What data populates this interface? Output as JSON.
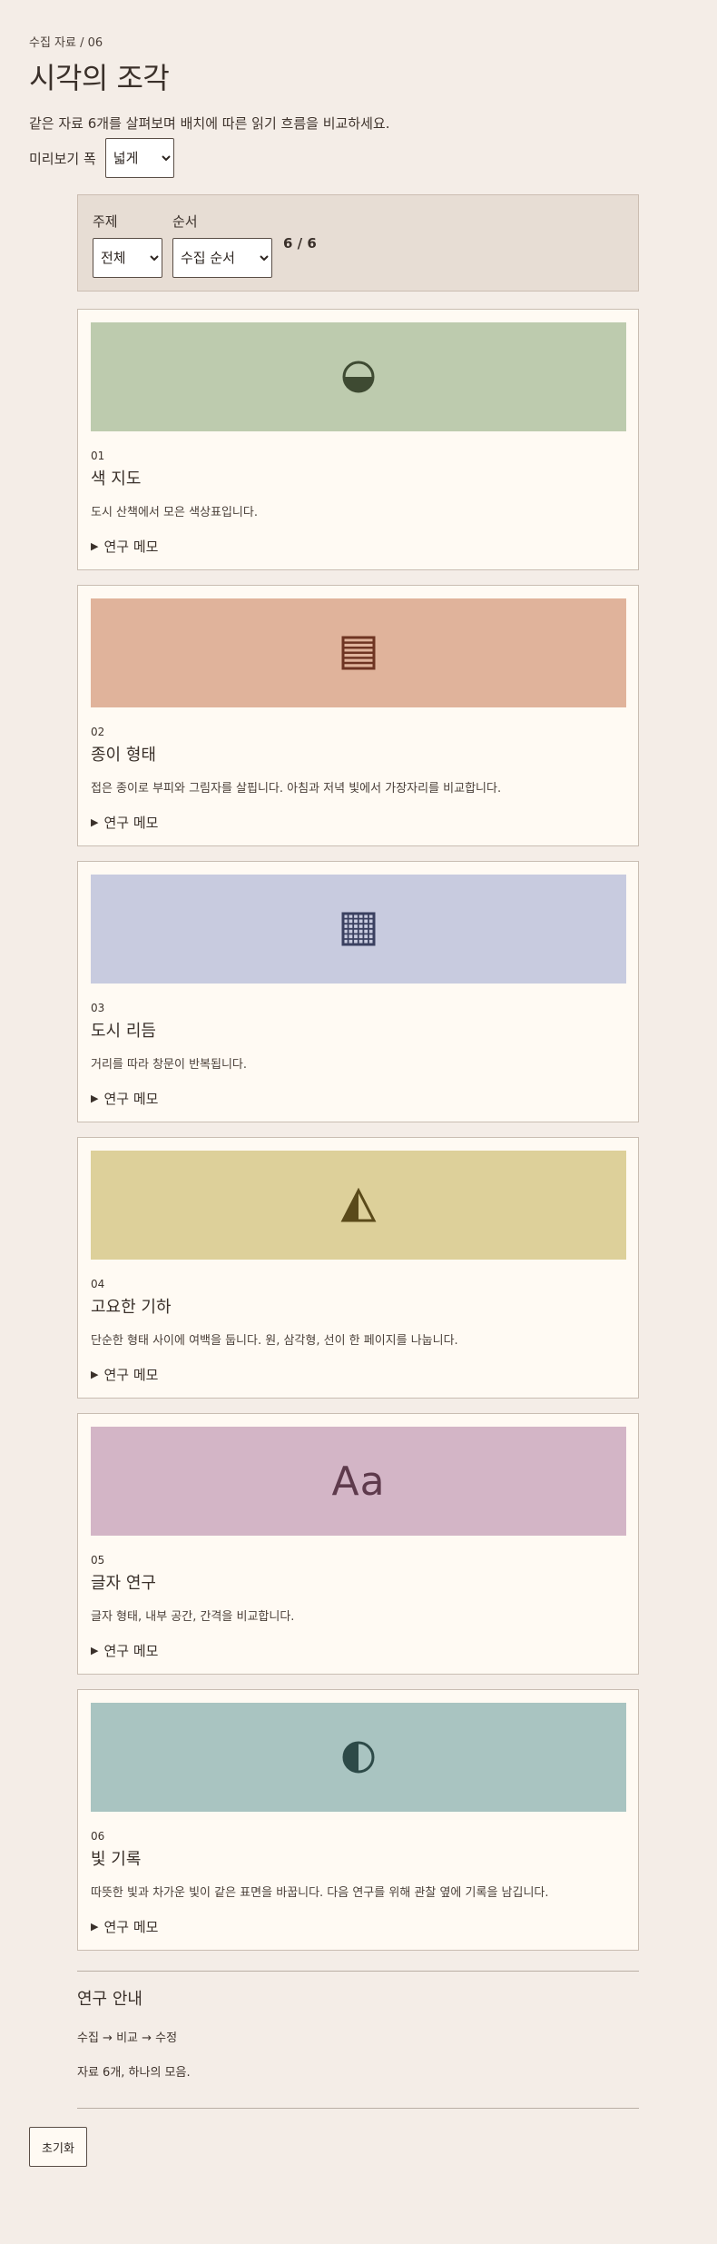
{
  "header": {
    "eyebrow": "수집 자료 / 06",
    "title": "시각의 조각",
    "intro": "같은 자료 6개를 살펴보며 배치에 따른 읽기 흐름을 비교하세요."
  },
  "width_control": {
    "label": "미리보기 폭",
    "selected": "넓게"
  },
  "filters": {
    "topic_label": "주제",
    "topic_selected": "전체",
    "order_label": "순서",
    "order_selected": "수집 순서",
    "count": "6 / 6"
  },
  "cards": [
    {
      "num": "01",
      "title": "색 지도",
      "desc": "도시 산책에서 모은 색상표입니다.",
      "memo": "연구 메모",
      "icon": "half-filled-circle-icon",
      "bg": "#bdcbae",
      "fg": "#3e4a32"
    },
    {
      "num": "02",
      "title": "종이 형태",
      "desc": "접은 종이로 부피와 그림자를 살핍니다. 아침과 저녁 빛에서 가장자리를 비교합니다.",
      "memo": "연구 메모",
      "icon": "striped-square-icon",
      "bg": "#e0b39b",
      "fg": "#6e3422"
    },
    {
      "num": "03",
      "title": "도시 리듬",
      "desc": "거리를 따라 창문이 반복됩니다.",
      "memo": "연구 메모",
      "icon": "grid-square-icon",
      "bg": "#c8cbdf",
      "fg": "#3a4060"
    },
    {
      "num": "04",
      "title": "고요한 기하",
      "desc": "단순한 형태 사이에 여백을 둡니다. 원, 삼각형, 선이 한 페이지를 나눕니다.",
      "memo": "연구 메모",
      "icon": "half-triangle-icon",
      "bg": "#ddd09a",
      "fg": "#5a4a1a"
    },
    {
      "num": "05",
      "title": "글자 연구",
      "desc": "글자 형태, 내부 공간, 간격을 비교합니다.",
      "memo": "연구 메모",
      "icon": "type-aa-icon",
      "glyph": "Aa",
      "bg": "#d3b5c6",
      "fg": "#5e3a4c"
    },
    {
      "num": "06",
      "title": "빛 기록",
      "desc": "따뜻한 빛과 차가운 빛이 같은 표면을 바꿉니다. 다음 연구를 위해 관찰 옆에 기록을 남깁니다.",
      "memo": "연구 메모",
      "icon": "half-moon-circle-icon",
      "bg": "#a9c4c1",
      "fg": "#2d4a48"
    }
  ],
  "footer": {
    "title": "연구 안내",
    "flow": "수집 → 비교 → 수정",
    "summary": "자료 6개, 하나의 모음."
  },
  "reset_label": "초기화"
}
